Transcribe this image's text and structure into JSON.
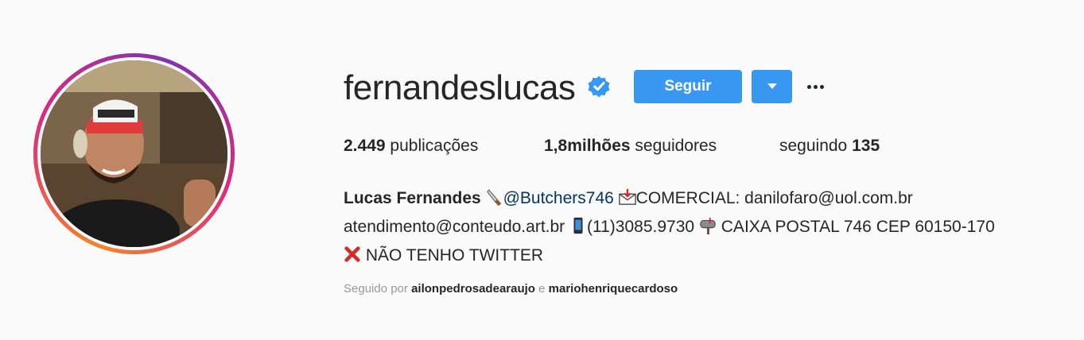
{
  "profile": {
    "username": "fernandeslucas",
    "verified_icon": "verified-badge-icon",
    "follow_label": "Seguir",
    "dropdown_icon": "caret-down-icon",
    "more_icon": "more-options-icon"
  },
  "stats": {
    "posts_count": "2.449",
    "posts_label": "publicações",
    "followers_count": "1,8milhões",
    "followers_label": "seguidores",
    "following_label": "seguindo",
    "following_count": "135"
  },
  "bio": {
    "name": "Lucas Fernandes",
    "mention": "@Butchers746",
    "commercial": "COMERCIAL: danilofaro@uol.com.br",
    "email": "atendimento@conteudo.art.br",
    "phone": "(11)3085.9730",
    "po_box": "CAIXA POSTAL 746 CEP 60150-170",
    "no_twitter": "NÃO TENHO TWITTER"
  },
  "followed_by": {
    "prefix": "Seguido por",
    "user1": "ailonpedrosadearaujo",
    "conjunction": "e",
    "user2": "mariohenriquecardoso"
  },
  "colors": {
    "accent": "#3897f0",
    "text": "#262626",
    "muted": "#999999",
    "background": "#fafafa"
  }
}
